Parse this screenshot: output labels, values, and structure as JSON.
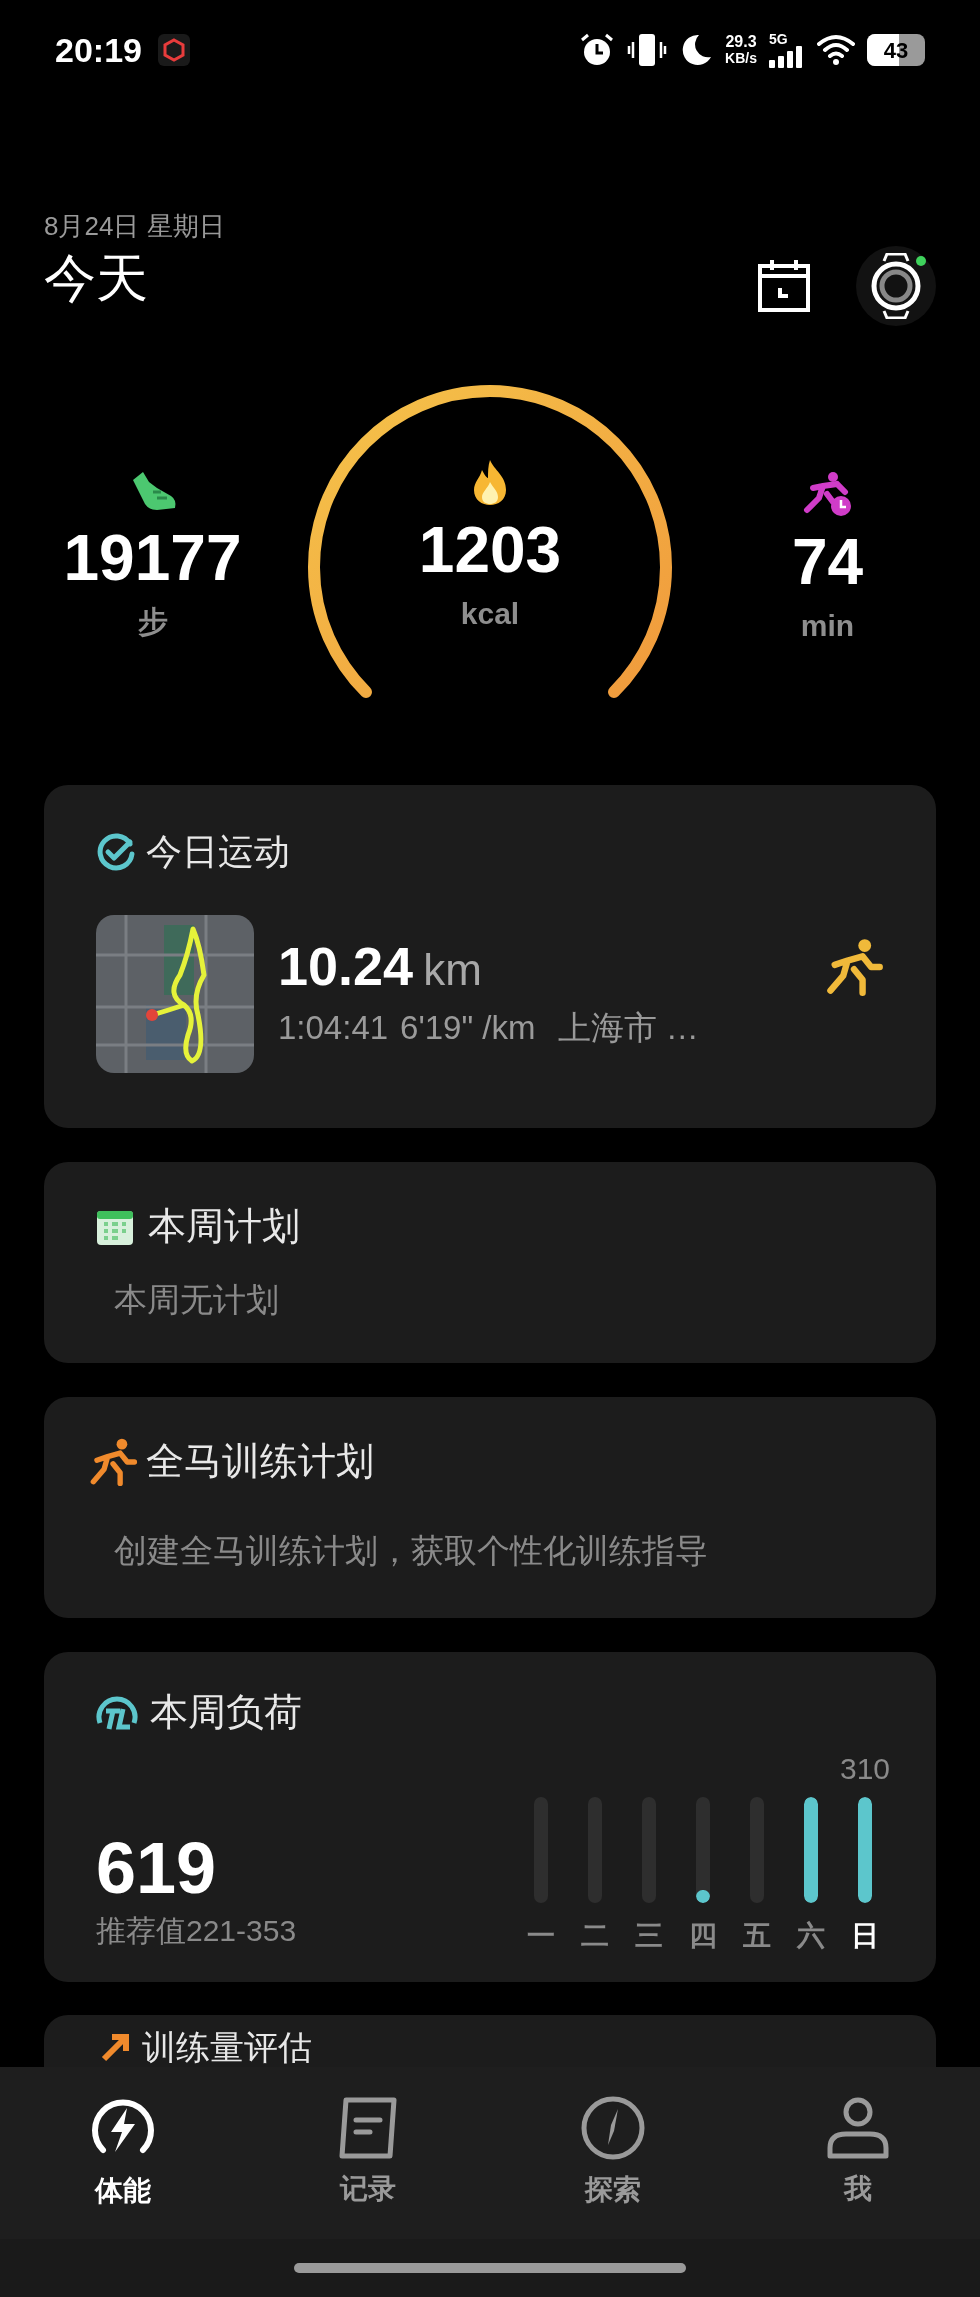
{
  "status_bar": {
    "time": "20:19",
    "net_speed": "29.3",
    "net_unit": "KB/s",
    "network": "5G",
    "battery": "43"
  },
  "header": {
    "date": "8月24日 星期日",
    "title": "今天"
  },
  "stats": [
    {
      "kind": "steps",
      "value": "19177",
      "unit": "步"
    },
    {
      "kind": "calories",
      "value": "1203",
      "unit": "kcal"
    },
    {
      "kind": "minutes",
      "value": "74",
      "unit": "min"
    }
  ],
  "today_workout": {
    "title": "今日运动",
    "distance": "10.24",
    "distance_unit": "km",
    "duration": "1:04:41",
    "pace": "6'19\" /km",
    "location": "上海市 …"
  },
  "weekly_plan": {
    "title": "本周计划",
    "subtitle": "本周无计划"
  },
  "marathon_plan": {
    "title": "全马训练计划",
    "subtitle": "创建全马训练计划，获取个性化训练指导"
  },
  "weekly_load": {
    "title": "本周负荷",
    "value": "619",
    "recommended": "推荐值221-353",
    "peak_label": "310",
    "days": [
      {
        "label": "一",
        "selected": false
      },
      {
        "label": "二",
        "selected": false
      },
      {
        "label": "三",
        "selected": false
      },
      {
        "label": "四",
        "level": 0.06,
        "selected": false
      },
      {
        "label": "五",
        "selected": false
      },
      {
        "label": "六",
        "level": 1,
        "selected": false
      },
      {
        "label": "日",
        "level": 1,
        "selected": true
      }
    ]
  },
  "training_assessment": {
    "title": "训练量评估"
  },
  "tabs": [
    {
      "kind": "fitness",
      "label": "体能",
      "selected": true
    },
    {
      "kind": "records",
      "label": "记录",
      "selected": false
    },
    {
      "kind": "explore",
      "label": "探索",
      "selected": false
    },
    {
      "kind": "me",
      "label": "我",
      "selected": false
    }
  ]
}
